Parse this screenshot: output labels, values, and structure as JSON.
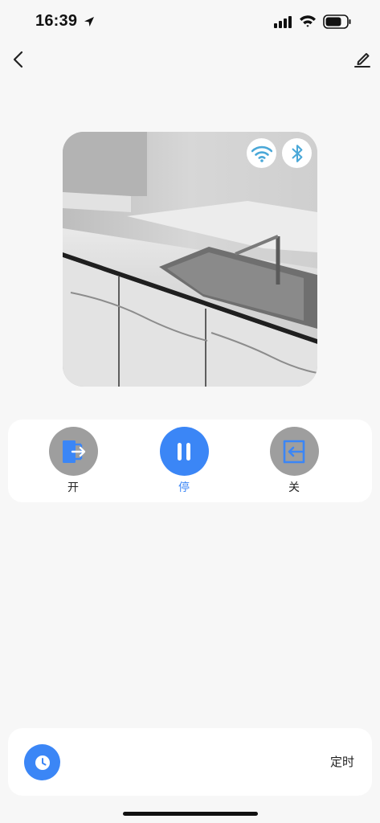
{
  "status_bar": {
    "time": "16:39",
    "icons": [
      "location-arrow-icon",
      "cellular-signal-icon",
      "wifi-icon",
      "battery-icon"
    ]
  },
  "nav": {
    "back_icon": "chevron-left-icon",
    "edit_icon": "pencil-icon"
  },
  "device": {
    "image": "kitchen-countertop-sink-photo",
    "connections": [
      "wifi-icon",
      "bluetooth-icon"
    ]
  },
  "controls": [
    {
      "label": "开",
      "icon": "door-open-icon",
      "active": false
    },
    {
      "label": "停",
      "icon": "pause-icon",
      "active": true
    },
    {
      "label": "关",
      "icon": "door-close-icon",
      "active": false
    }
  ],
  "timer": {
    "icon": "clock-icon",
    "label": "定时"
  },
  "colors": {
    "accent": "#3b86f6",
    "inactive": "#9e9e9e",
    "background": "#f7f7f7",
    "card": "#ffffff",
    "wifi_badge": "#4aa8d8"
  }
}
